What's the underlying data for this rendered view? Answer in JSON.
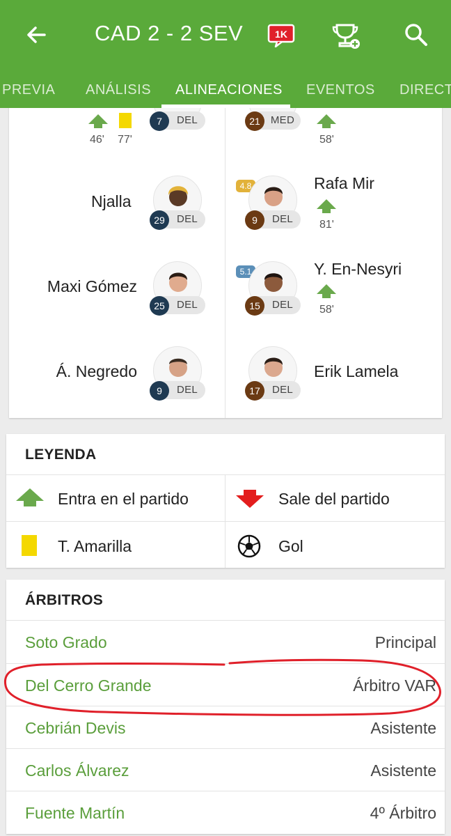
{
  "header": {
    "title": "CAD 2 - 2 SEV",
    "badge": "1K",
    "icons": [
      "back-arrow-icon",
      "comments-badge-icon",
      "trophy-add-icon",
      "search-icon"
    ]
  },
  "tabs": [
    {
      "label": "PREVIA"
    },
    {
      "label": "ANÁLISIS"
    },
    {
      "label": "ALINEACIONES"
    },
    {
      "label": "EVENTOS"
    },
    {
      "label": "DIRECTO"
    }
  ],
  "lineup": {
    "home": [
      {
        "name": "",
        "number": "7",
        "pos": "DEL",
        "sub_minute": "46'",
        "card_minute": "77'"
      },
      {
        "name": "Njalla",
        "number": "29",
        "pos": "DEL"
      },
      {
        "name": "Maxi Gómez",
        "number": "25",
        "pos": "DEL"
      },
      {
        "name": "Á. Negredo",
        "number": "9",
        "pos": "DEL"
      }
    ],
    "away": [
      {
        "name": "",
        "number": "21",
        "pos": "MED",
        "sub_minute": "58'"
      },
      {
        "name": "Rafa Mir",
        "number": "9",
        "pos": "DEL",
        "rating": "4.8",
        "sub_minute": "81'"
      },
      {
        "name": "Y. En-Nesyri",
        "number": "15",
        "pos": "DEL",
        "rating": "5.1",
        "sub_minute": "58'"
      },
      {
        "name": "Erik Lamela",
        "number": "17",
        "pos": "DEL"
      }
    ]
  },
  "legend": {
    "title": "LEYENDA",
    "items": [
      {
        "label": "Entra en el partido",
        "icon": "sub-in-arrow-icon"
      },
      {
        "label": "Sale del partido",
        "icon": "sub-out-arrow-icon"
      },
      {
        "label": "T. Amarilla",
        "icon": "yellow-card-icon"
      },
      {
        "label": "Gol",
        "icon": "soccer-ball-icon"
      }
    ]
  },
  "referees": {
    "title": "ÁRBITROS",
    "rows": [
      {
        "name": "Soto Grado",
        "role": "Principal"
      },
      {
        "name": "Del Cerro Grande",
        "role": "Árbitro VAR"
      },
      {
        "name": "Cebrián Devis",
        "role": "Asistente"
      },
      {
        "name": "Carlos Álvarez",
        "role": "Asistente"
      },
      {
        "name": "Fuente Martín",
        "role": "4º Árbitro"
      }
    ]
  },
  "colors": {
    "brand_green": "#5aaa3a",
    "link_green": "#5a9e3b",
    "home_number": "#1f3a52",
    "away_number": "#6b3a13",
    "rating_orange": "#e2b23a",
    "rating_blue": "#5b8fb8",
    "annotation_red": "#e0202a"
  }
}
